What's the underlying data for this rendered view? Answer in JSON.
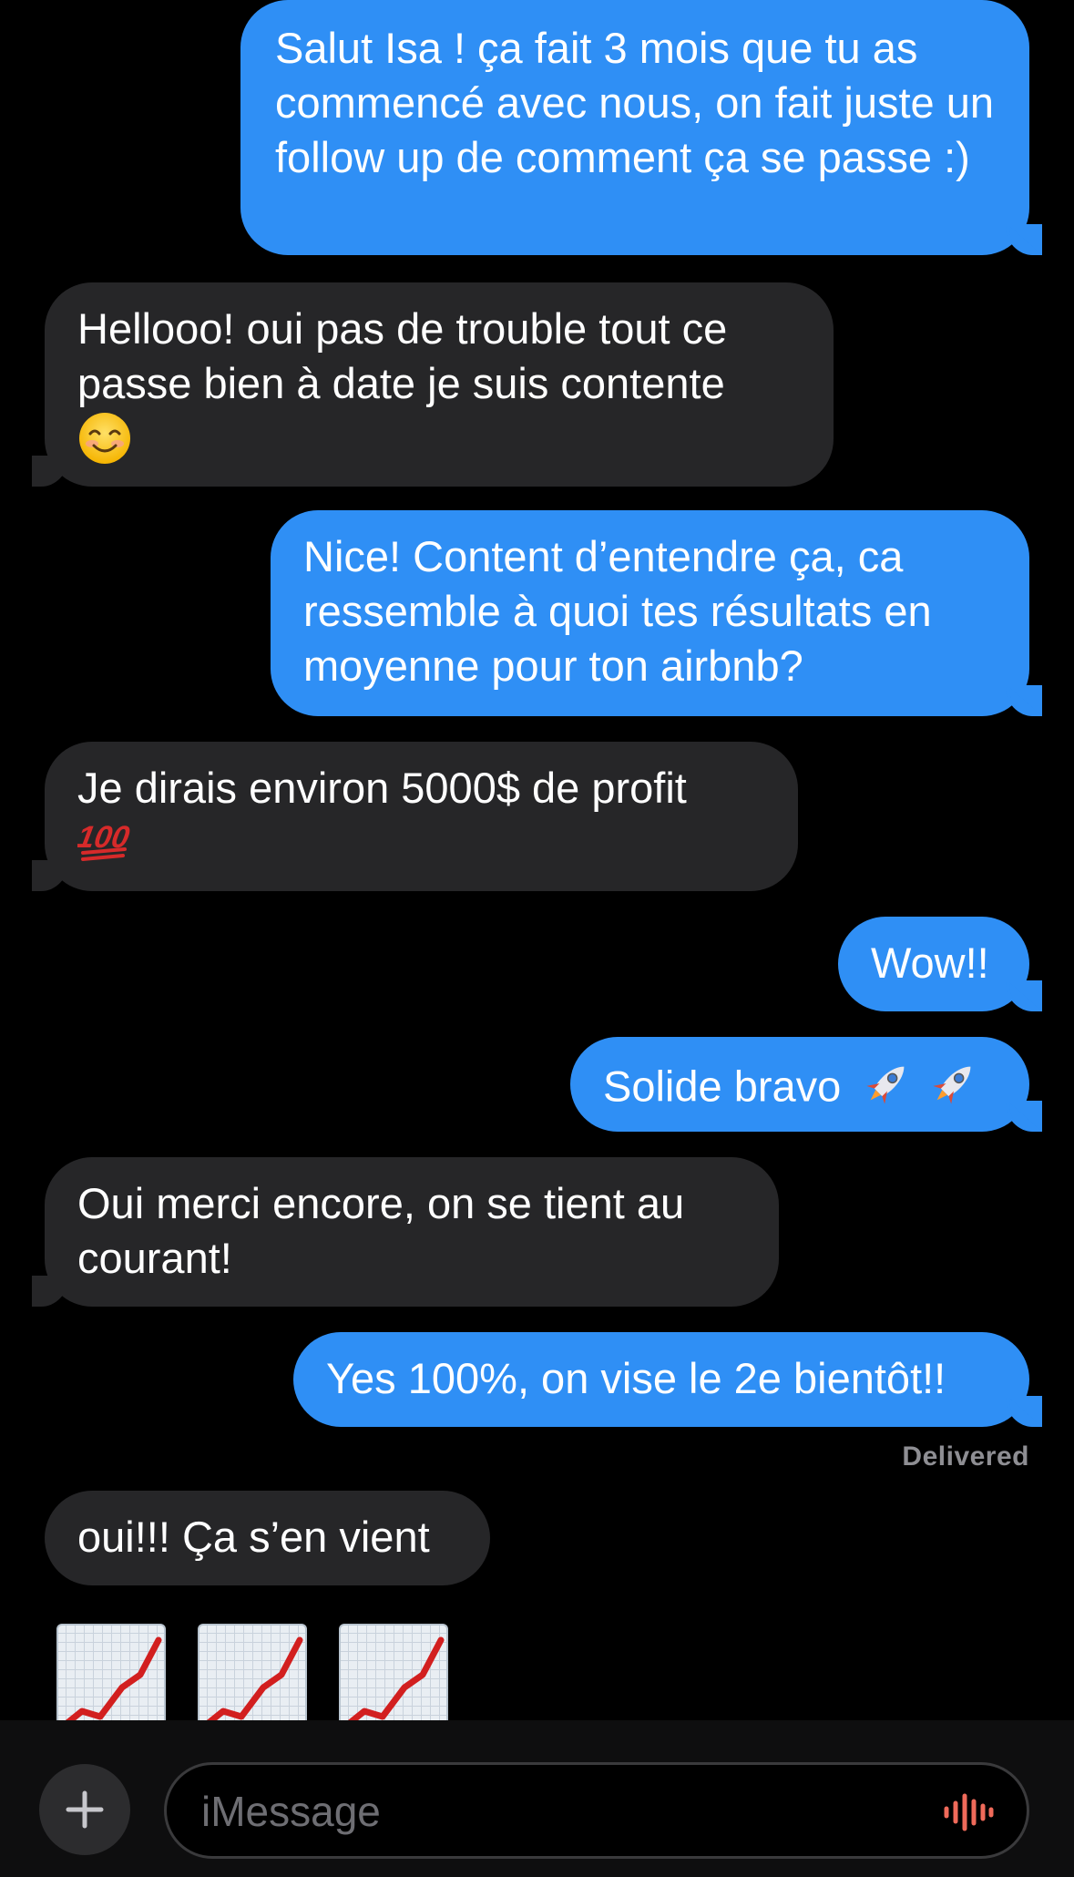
{
  "messages": [
    {
      "direction": "sent",
      "text": "Salut Isa ! ça fait 3 mois que tu as commencé avec nous, on fait juste un follow up de comment ça se passe :)"
    },
    {
      "direction": "received",
      "text": "Hellooo! oui pas de trouble tout ce passe bien à date je suis contente",
      "emoji": "smiling-face-icon"
    },
    {
      "direction": "sent",
      "text": "Nice! Content d’entendre ça, ca ressemble à quoi tes résultats en moyenne pour ton airbnb?"
    },
    {
      "direction": "received",
      "text": "Je dirais environ 5000$ de profit",
      "emoji": "hundred-points-icon"
    },
    {
      "direction": "sent",
      "text": "Wow!!"
    },
    {
      "direction": "sent",
      "text": "Solide bravo",
      "emoji": "rocket-icon x2"
    },
    {
      "direction": "received",
      "text": "Oui merci encore, on se tient au courant!"
    },
    {
      "direction": "sent",
      "text": "Yes 100%, on vise le 2e bientôt!!"
    },
    {
      "direction": "received",
      "text": "oui!!! Ça s’en vient"
    }
  ],
  "status": "Delivered",
  "trailing_emojis": [
    "chart-increasing-icon",
    "chart-increasing-icon",
    "chart-increasing-icon"
  ],
  "composer": {
    "placeholder": "iMessage",
    "plus_icon": "plus-icon",
    "audio_icon": "audio-waveform-icon"
  },
  "colors": {
    "sent_bubble": "#2f8ff5",
    "received_bubble": "#262628",
    "background": "#000000",
    "status_text": "#8e8e93",
    "audio_icon": "#ef6a5a"
  }
}
